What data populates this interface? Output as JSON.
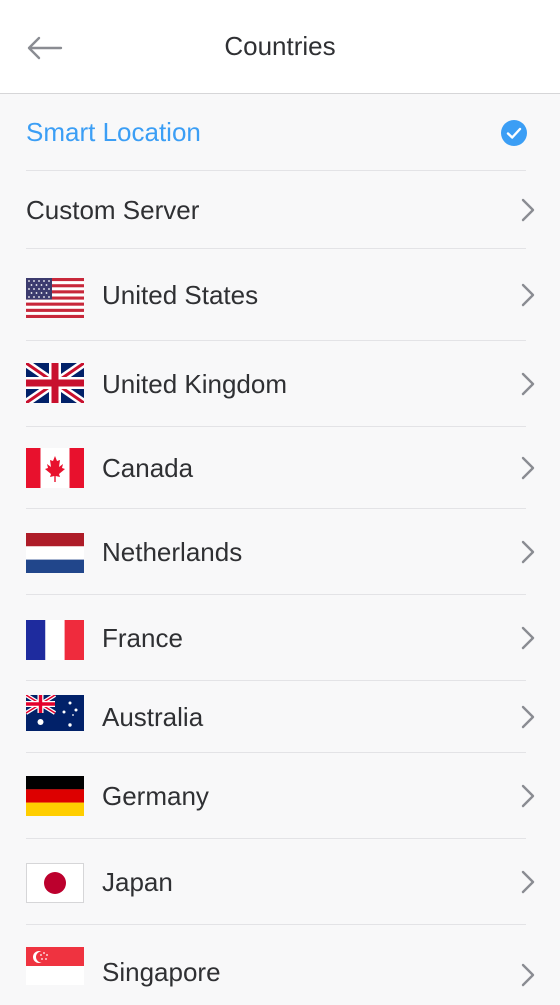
{
  "header": {
    "title": "Countries",
    "back_icon": "arrow-left-icon"
  },
  "colors": {
    "accent": "#3b9ef5",
    "text": "#2f3033",
    "chevron": "#8a8c92"
  },
  "list": {
    "smart_location": {
      "label": "Smart Location",
      "selected": true,
      "icon": "check-circle-icon"
    },
    "custom_server": {
      "label": "Custom Server",
      "icon": "chevron-right-icon"
    },
    "countries": [
      {
        "label": "United States",
        "flag": "us-flag-icon"
      },
      {
        "label": "United Kingdom",
        "flag": "uk-flag-icon"
      },
      {
        "label": "Canada",
        "flag": "canada-flag-icon"
      },
      {
        "label": "Netherlands",
        "flag": "netherlands-flag-icon"
      },
      {
        "label": "France",
        "flag": "france-flag-icon"
      },
      {
        "label": "Australia",
        "flag": "australia-flag-icon"
      },
      {
        "label": "Germany",
        "flag": "germany-flag-icon"
      },
      {
        "label": "Japan",
        "flag": "japan-flag-icon"
      },
      {
        "label": "Singapore",
        "flag": "singapore-flag-icon"
      }
    ]
  }
}
